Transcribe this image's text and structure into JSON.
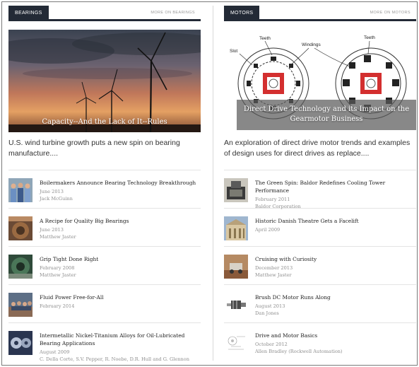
{
  "left": {
    "category": "Bearings",
    "more": "More on Bearings",
    "feature": {
      "caption": "Capacity--And the Lack of It--Rules",
      "excerpt": "U.S. wind turbine growth puts a new spin on bearing manufacture...."
    },
    "articles": [
      {
        "title": "Boilermakers Announce Bearing Technology Breakthrough",
        "date": "June 2013",
        "author": "Jack McGuinn"
      },
      {
        "title": "A Recipe for Quality Big Bearings",
        "date": "June 2013",
        "author": "Matthew Jaster"
      },
      {
        "title": "Grip Tight Done Right",
        "date": "February 2008",
        "author": "Matthew Jaster"
      },
      {
        "title": "Fluid Power Free-for-All",
        "date": "February 2014",
        "author": ""
      },
      {
        "title": "Intermetallic Nickel-Titanium Alloys for Oil-Lubricated Bearing Applications",
        "date": "August 2009",
        "author": "C. Della Corte, S.V. Pepper, R. Noebe, D.R. Hull and G. Glennon"
      }
    ]
  },
  "right": {
    "category": "Motors",
    "more": "More on Motors",
    "feature": {
      "caption": "Direct Drive Technology and its Impact on the Gearmotor Business",
      "excerpt": "An exploration of direct drive motor trends and examples of design uses for direct drives as replace....",
      "diagram_labels": {
        "teeth": "Teeth",
        "windings": "Windings",
        "slot": "Slot"
      }
    },
    "articles": [
      {
        "title": "The Green Spin: Baldor Redefines Cooling Tower Performance",
        "date": "February 2011",
        "author": "Baldor Corporation"
      },
      {
        "title": "Historic Danish Theatre Gets a Facelift",
        "date": "April 2009",
        "author": ""
      },
      {
        "title": "Cruising with Curiosity",
        "date": "December 2013",
        "author": "Matthew Jaster"
      },
      {
        "title": "Brush DC Motor Runs Along",
        "date": "August 2013",
        "author": "Dan Jones"
      },
      {
        "title": "Drive and Motor Basics",
        "date": "October 2012",
        "author": "Allen Bradley (Rockwell Automation)"
      }
    ]
  },
  "colors": {
    "header": "#232a36",
    "accent_red": "#d32f2f"
  }
}
